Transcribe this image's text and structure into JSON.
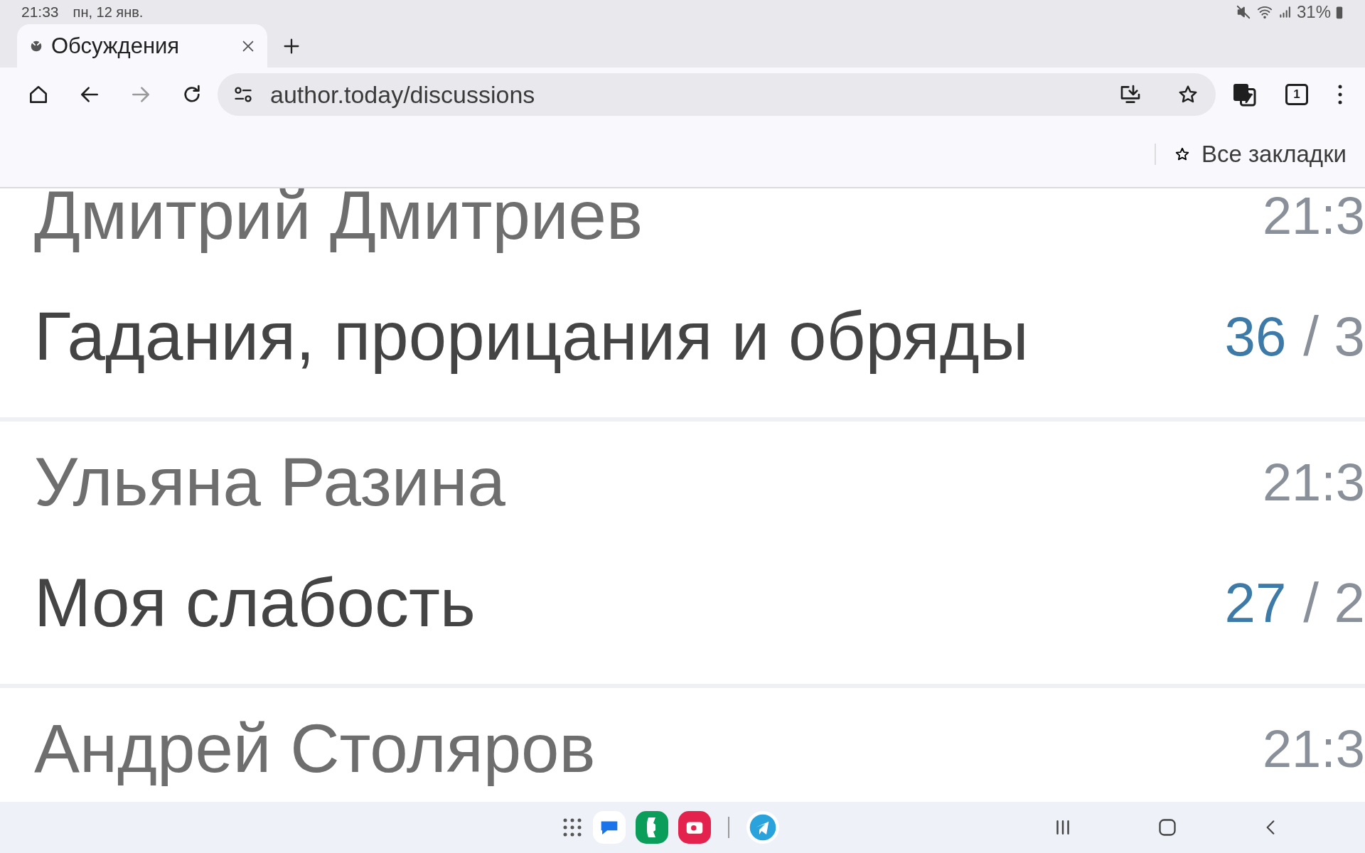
{
  "status_bar": {
    "time": "21:33",
    "date": "пн, 12 янв.",
    "battery": "31%"
  },
  "tabs": [
    {
      "title": "Обсуждения",
      "selected": true
    }
  ],
  "address_bar": {
    "url": "author.today/discussions"
  },
  "tab_count": "1",
  "bookmarks_bar": {
    "label": "Все закладки"
  },
  "discussions": [
    {
      "author": "Дмитрий Дмитриев",
      "time": "21:3",
      "title": "Гадания, прорицания и обряды",
      "count_new": "36",
      "count_total": "/ 3"
    },
    {
      "author": "Ульяна Разина",
      "time": "21:3",
      "title": "Моя слабость",
      "count_new": "27",
      "count_total": "/ 2"
    },
    {
      "author": "Андрей Столяров",
      "time": "21:3"
    }
  ]
}
